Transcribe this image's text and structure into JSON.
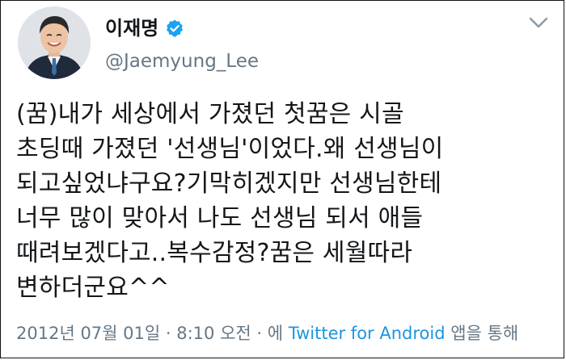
{
  "author": {
    "name": "이재명",
    "handle": "@Jaemyung_Lee",
    "verified": true
  },
  "tweet": {
    "lines": [
      "(꿈)내가 세상에서 가졌던 첫꿈은 시골",
      "초딩때 가졌던 '선생님'이었다.왜 선생님이",
      "되고싶었냐구요?기막히겠지만 선생님한테",
      "너무 많이 맞아서 나도 선생님 되서 애들",
      "때려보겠다고..복수감정?꿈은 세월따라",
      "변하더군요^^"
    ]
  },
  "meta": {
    "date": "2012년 07월 01일",
    "sep1": " · ",
    "time": "8:10 오전",
    "sep2": " · ",
    "via_prefix": "에 ",
    "source": "Twitter for Android",
    "via_suffix": " 앱을 통해"
  },
  "colors": {
    "accent": "#1b95e0",
    "muted": "#657786",
    "text": "#14171a"
  },
  "icons": {
    "verified": "verified-badge-icon",
    "menu": "chevron-down-icon"
  }
}
